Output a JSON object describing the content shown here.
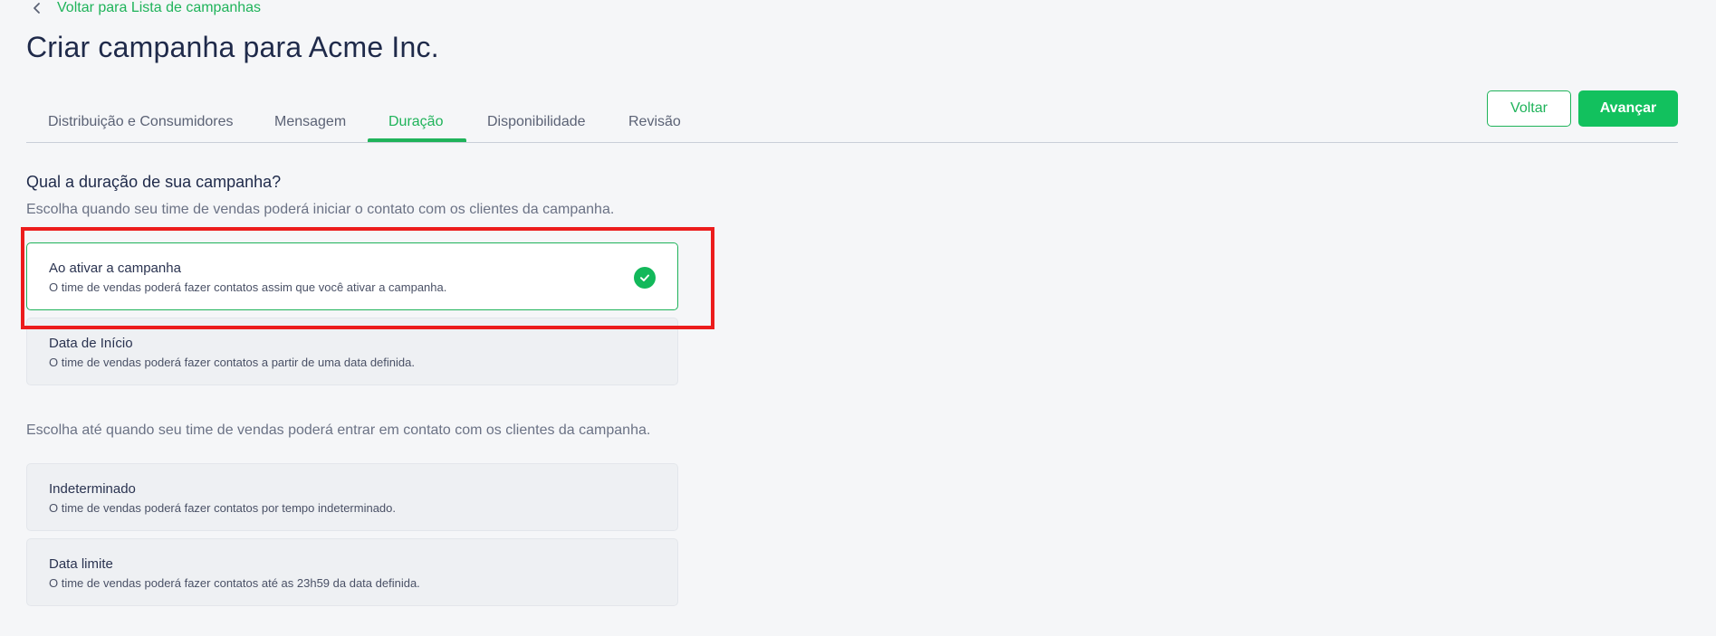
{
  "back_link": {
    "label": "Voltar para Lista de campanhas",
    "icon": "chevron-left-icon"
  },
  "page_title": "Criar campanha para Acme Inc.",
  "tabs": [
    {
      "label": "Distribuição e Consumidores",
      "active": false
    },
    {
      "label": "Mensagem",
      "active": false
    },
    {
      "label": "Duração",
      "active": true
    },
    {
      "label": "Disponibilidade",
      "active": false
    },
    {
      "label": "Revisão",
      "active": false
    }
  ],
  "actions": {
    "back_label": "Voltar",
    "next_label": "Avançar"
  },
  "duration": {
    "heading": "Qual a duração de sua campanha?",
    "start_helper": "Escolha quando seu time de vendas poderá iniciar o contato com os clientes da campanha.",
    "start_options": [
      {
        "title": "Ao ativar a campanha",
        "description": "O time de vendas poderá fazer contatos assim que você ativar a campanha.",
        "selected": true
      },
      {
        "title": "Data de Início",
        "description": "O time de vendas poderá fazer contatos a partir de uma data definida.",
        "selected": false
      }
    ],
    "end_helper": "Escolha até quando seu time de vendas poderá entrar em contato com os clientes da campanha.",
    "end_options": [
      {
        "title": "Indeterminado",
        "description": "O time de vendas poderá fazer contatos por tempo indeterminado.",
        "selected": false
      },
      {
        "title": "Data limite",
        "description": "O time de vendas poderá fazer contatos até as 23h59 da data definida.",
        "selected": false
      }
    ]
  },
  "colors": {
    "accent": "#1fb35a",
    "primary_button": "#12c15e",
    "highlight": "#ec1c1c",
    "background": "#f5f6f8"
  }
}
